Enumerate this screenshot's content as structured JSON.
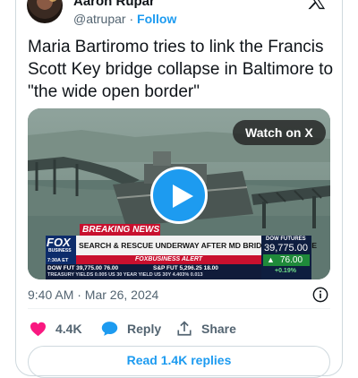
{
  "author": {
    "name": "Aaron Rupar",
    "handle": "@atrupar",
    "separator": "·",
    "follow_label": "Follow"
  },
  "tweet": {
    "text": "Maria Bartiromo tries to link the Francis Scott Key bridge collapse in Baltimore to \"the wide open border\"",
    "timestamp": "9:40 AM · Mar 26, 2024"
  },
  "media": {
    "watch_label": "Watch on X",
    "network_logo": "FOX",
    "network_sub": "BUSINESS",
    "local_time": "7:30A ET",
    "breaking_label": "BREAKING NEWS",
    "headline": "SEARCH & RESCUE UNDERWAY AFTER MD BRIDGE COLLAPSE",
    "brand_bar": "FOXBUSINESS ALERT",
    "futures_label": "DOW FUTURES",
    "futures_value": "39,775.00",
    "futures_change": "76.00",
    "futures_pct": "+0.19%",
    "ticker_1": "DOW FUT  39,775.00    76.00",
    "ticker_2": "S&P FUT   5,296.25    18.00",
    "ticker_3": "TREASURY YIELDS  0.005  US 30 YEAR YIELD  US 30Y  4.403%  0.013"
  },
  "actions": {
    "like_count": "4.4K",
    "reply_label": "Reply",
    "share_label": "Share"
  },
  "read_replies_label": "Read 1.4K replies",
  "colors": {
    "accent": "#1d9bf0",
    "like": "#f91880",
    "muted": "#536471",
    "breaking_red": "#c8102e"
  }
}
